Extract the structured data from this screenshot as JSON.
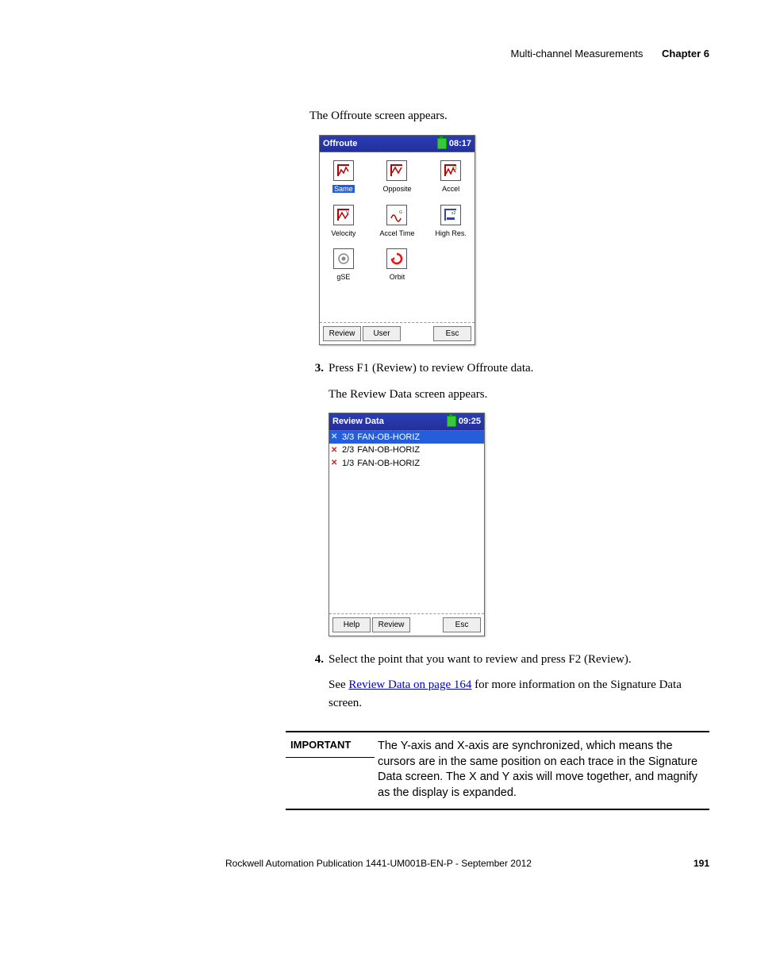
{
  "header": {
    "section": "Multi-channel Measurements",
    "chapter": "Chapter 6"
  },
  "content": {
    "intro_text": "The Offroute screen appears.",
    "step3_num": "3.",
    "step3_text": "Press F1 (Review) to review Offroute data.",
    "step3_followup": "The Review Data screen appears.",
    "step4_num": "4.",
    "step4_text": "Select the point that you want to review and press F2 (Review).",
    "see_prefix": "See ",
    "see_link": "Review Data on page 164",
    "see_suffix": " for more information on the Signature Data screen."
  },
  "offroute_screen": {
    "title": "Offroute",
    "time": "08:17",
    "items": [
      {
        "label": "Same",
        "selected": true
      },
      {
        "label": "Opposite"
      },
      {
        "label": "Accel"
      },
      {
        "label": "Velocity"
      },
      {
        "label": "Accel Time"
      },
      {
        "label": "High Res."
      },
      {
        "label": "gSE"
      },
      {
        "label": "Orbit"
      }
    ],
    "btn_left1": "Review",
    "btn_left2": "User",
    "btn_right": "Esc"
  },
  "review_screen": {
    "title": "Review Data",
    "time": "09:25",
    "rows": [
      {
        "idx": "3/3",
        "name": "FAN-OB-HORIZ",
        "selected": true
      },
      {
        "idx": "2/3",
        "name": "FAN-OB-HORIZ"
      },
      {
        "idx": "1/3",
        "name": "FAN-OB-HORIZ"
      }
    ],
    "btn_left1": "Help",
    "btn_left2": "Review",
    "btn_right": "Esc"
  },
  "important": {
    "label": "IMPORTANT",
    "text": "The Y-axis and X-axis are synchronized, which means the cursors are in the same position on each trace in the Signature Data screen. The X and Y axis will move together, and magnify as the display is expanded."
  },
  "footer": {
    "publication": "Rockwell Automation Publication 1441-UM001B-EN-P - September 2012",
    "page_number": "191"
  }
}
